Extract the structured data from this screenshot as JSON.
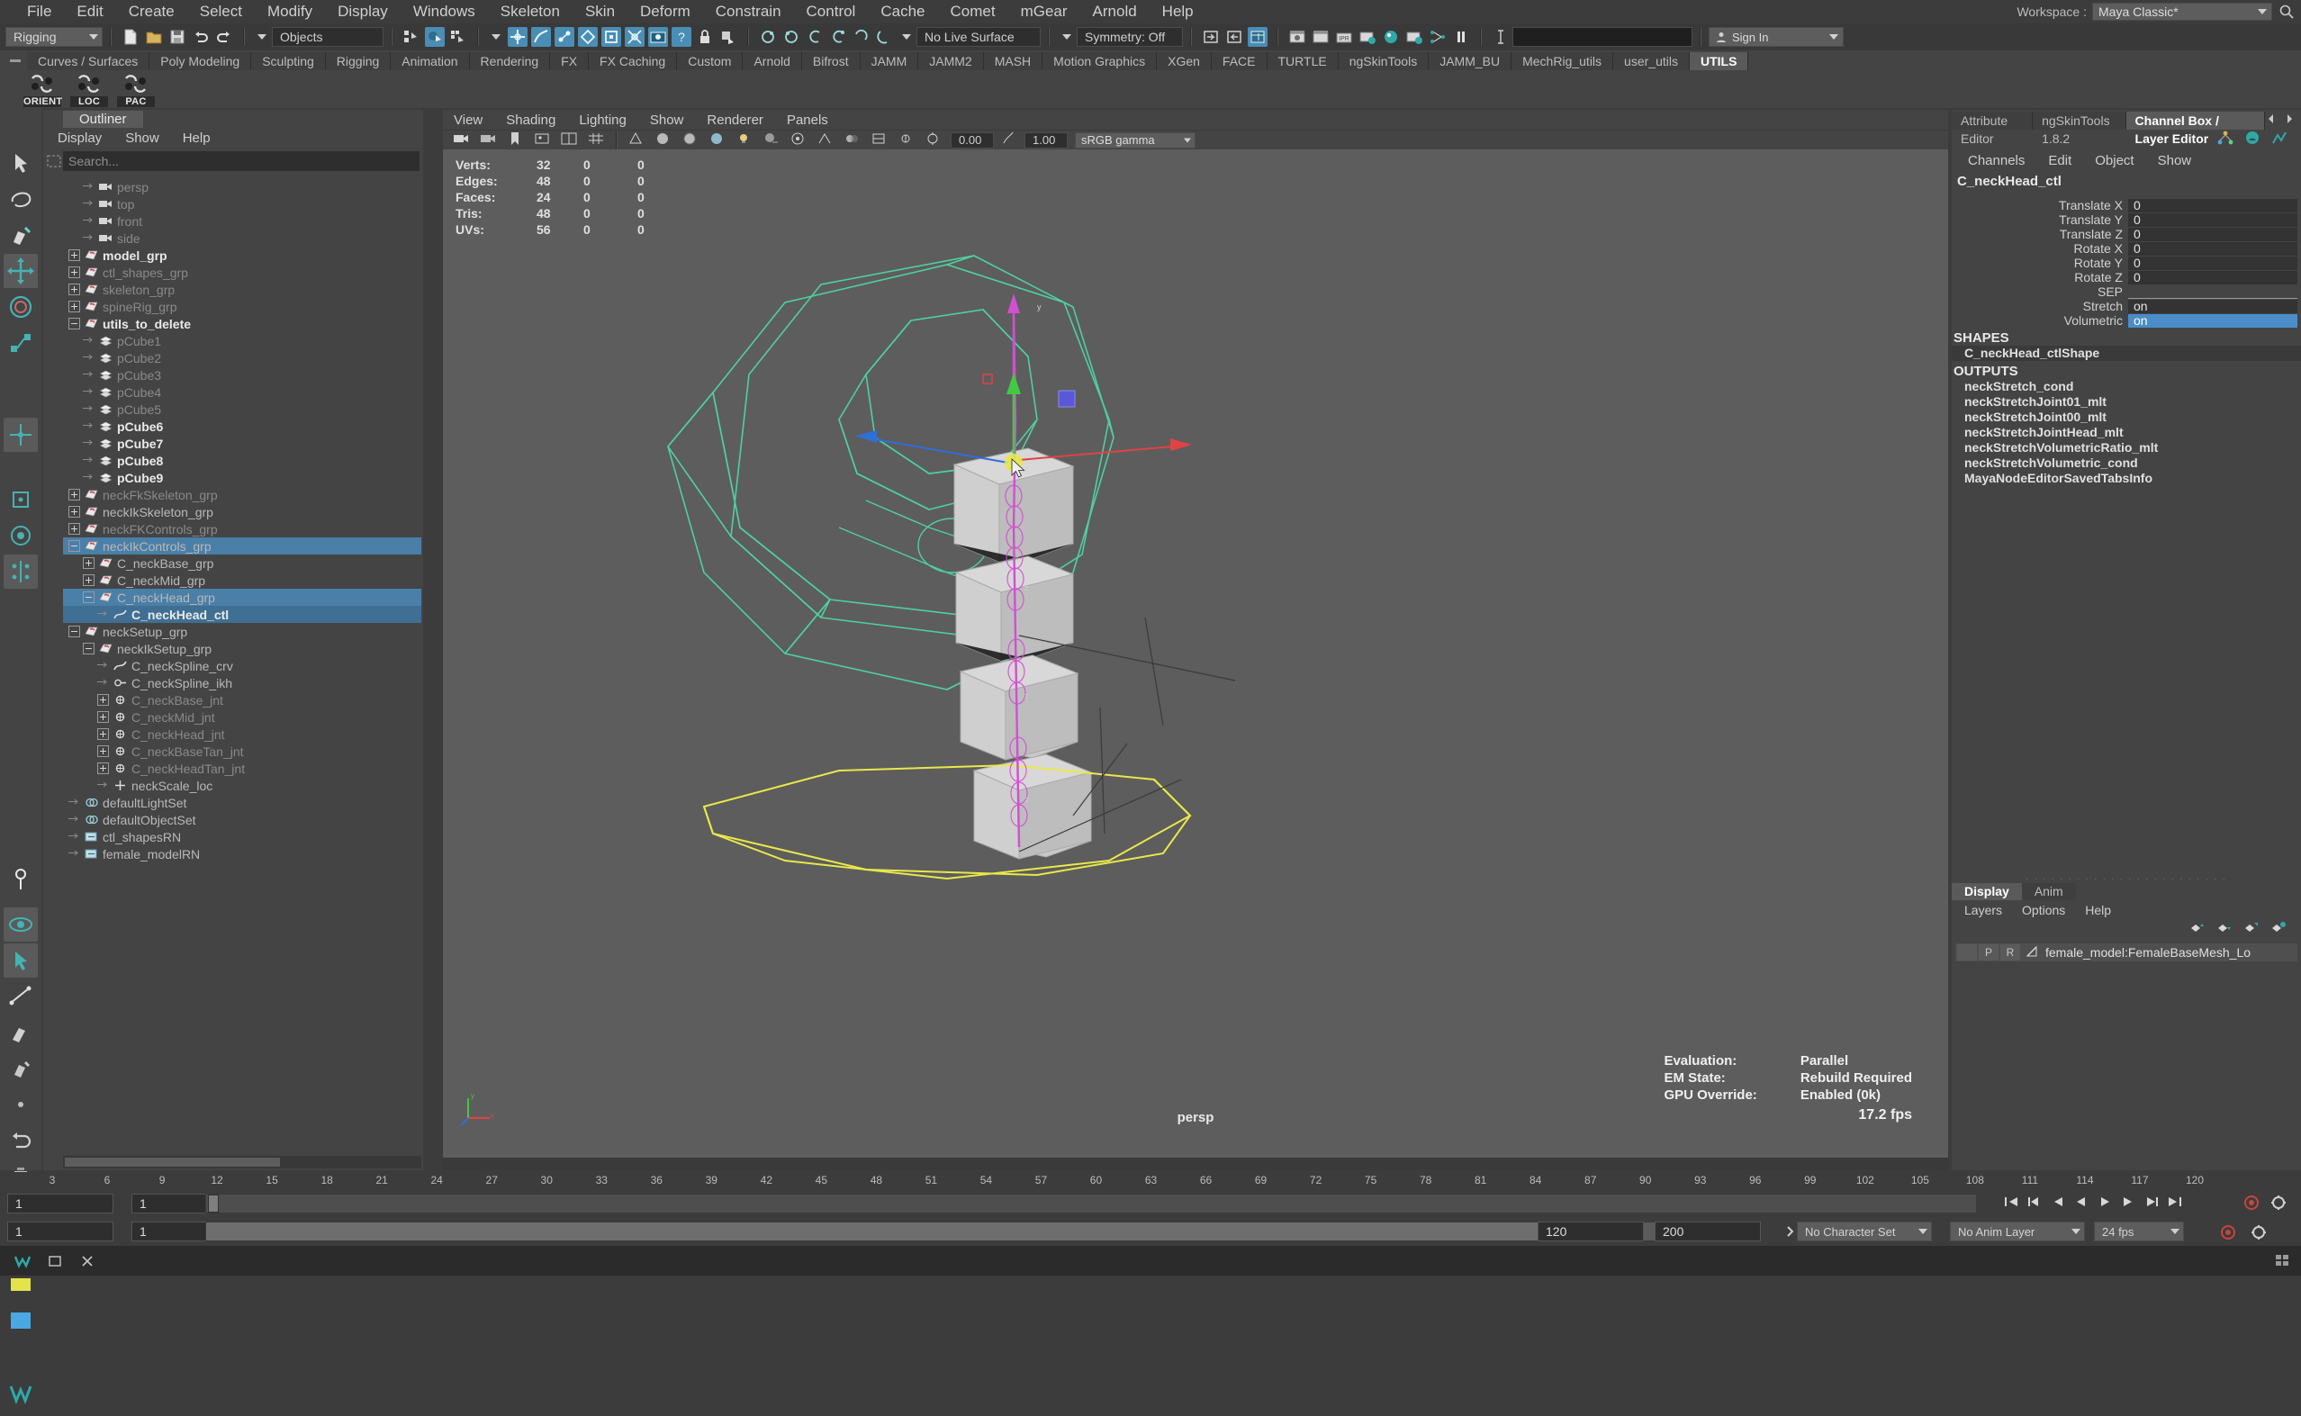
{
  "app": {
    "title": "Maya Classic*",
    "workspace_label": "Workspace :"
  },
  "menubar": {
    "items": [
      "File",
      "Edit",
      "Create",
      "Select",
      "Modify",
      "Display",
      "Windows",
      "Skeleton",
      "Skin",
      "Deform",
      "Constrain",
      "Control",
      "Cache",
      "Comet",
      "mGear",
      "Arnold",
      "Help"
    ]
  },
  "statusline": {
    "mode": "Rigging",
    "selection_mask": "Objects",
    "live_surface": "No Live Surface",
    "symmetry": "Symmetry: Off",
    "command_value": "",
    "signin": "Sign In"
  },
  "shelf": {
    "tabs": [
      "Curves / Surfaces",
      "Poly Modeling",
      "Sculpting",
      "Rigging",
      "Animation",
      "Rendering",
      "FX",
      "FX Caching",
      "Custom",
      "Arnold",
      "Bifrost",
      "JAMM",
      "JAMM2",
      "MASH",
      "Motion Graphics",
      "XGen",
      "FACE",
      "TURTLE",
      "ngSkinTools",
      "JAMM_BU",
      "MechRig_utils",
      "user_utils",
      "UTILS"
    ],
    "active_tab": "UTILS",
    "buttons": [
      {
        "label": "ORIENT",
        "icon": "orient-icon"
      },
      {
        "label": "LOC",
        "icon": "locator-icon"
      },
      {
        "label": "PAC",
        "icon": "parent-constraint-icon"
      }
    ]
  },
  "outliner": {
    "tab": "Outliner",
    "menus": [
      "Display",
      "Show",
      "Help"
    ],
    "search_placeholder": "Search...",
    "items": [
      {
        "label": "persp",
        "indent": 1,
        "icon": "camera-icon",
        "toggle": "none",
        "style": "dim"
      },
      {
        "label": "top",
        "indent": 1,
        "icon": "camera-icon",
        "toggle": "none",
        "style": "dim"
      },
      {
        "label": "front",
        "indent": 1,
        "icon": "camera-icon",
        "toggle": "none",
        "style": "dim"
      },
      {
        "label": "side",
        "indent": 1,
        "icon": "camera-icon",
        "toggle": "none",
        "style": "dim"
      },
      {
        "label": "model_grp",
        "indent": 0,
        "icon": "group-icon",
        "toggle": "plus",
        "style": "bright"
      },
      {
        "label": "ctl_shapes_grp",
        "indent": 0,
        "icon": "group-icon",
        "toggle": "plus",
        "style": "dim"
      },
      {
        "label": "skeleton_grp",
        "indent": 0,
        "icon": "group-icon",
        "toggle": "plus",
        "style": "dim"
      },
      {
        "label": "spineRig_grp",
        "indent": 0,
        "icon": "group-icon",
        "toggle": "plus",
        "style": "dim"
      },
      {
        "label": "utils_to_delete",
        "indent": 0,
        "icon": "group-icon",
        "toggle": "minus",
        "style": "bright"
      },
      {
        "label": "pCube1",
        "indent": 1,
        "icon": "mesh-icon",
        "toggle": "none",
        "style": "dim"
      },
      {
        "label": "pCube2",
        "indent": 1,
        "icon": "mesh-icon",
        "toggle": "none",
        "style": "dim"
      },
      {
        "label": "pCube3",
        "indent": 1,
        "icon": "mesh-icon",
        "toggle": "none",
        "style": "dim"
      },
      {
        "label": "pCube4",
        "indent": 1,
        "icon": "mesh-icon",
        "toggle": "none",
        "style": "dim"
      },
      {
        "label": "pCube5",
        "indent": 1,
        "icon": "mesh-icon",
        "toggle": "none",
        "style": "dim"
      },
      {
        "label": "pCube6",
        "indent": 1,
        "icon": "mesh-icon",
        "toggle": "none",
        "style": "bright"
      },
      {
        "label": "pCube7",
        "indent": 1,
        "icon": "mesh-icon",
        "toggle": "none",
        "style": "bright"
      },
      {
        "label": "pCube8",
        "indent": 1,
        "icon": "mesh-icon",
        "toggle": "none",
        "style": "bright"
      },
      {
        "label": "pCube9",
        "indent": 1,
        "icon": "mesh-icon",
        "toggle": "none",
        "style": "bright"
      },
      {
        "label": "neckFkSkeleton_grp",
        "indent": 0,
        "icon": "group-icon",
        "toggle": "plus",
        "style": "dim"
      },
      {
        "label": "neckIkSkeleton_grp",
        "indent": 0,
        "icon": "group-icon",
        "toggle": "plus",
        "style": "mid"
      },
      {
        "label": "neckFKControls_grp",
        "indent": 0,
        "icon": "group-icon",
        "toggle": "plus",
        "style": "dim"
      },
      {
        "label": "neckIkControls_grp",
        "indent": 0,
        "icon": "group-icon",
        "toggle": "minus",
        "style": "mid",
        "selected": true
      },
      {
        "label": "C_neckBase_grp",
        "indent": 1,
        "icon": "group-icon",
        "toggle": "plus",
        "style": "mid"
      },
      {
        "label": "C_neckMid_grp",
        "indent": 1,
        "icon": "group-icon",
        "toggle": "plus",
        "style": "mid"
      },
      {
        "label": "C_neckHead_grp",
        "indent": 1,
        "icon": "group-icon",
        "toggle": "minus",
        "style": "mid",
        "selected": true
      },
      {
        "label": "C_neckHead_ctl",
        "indent": 2,
        "icon": "curve-icon",
        "toggle": "none",
        "style": "bright",
        "selected_strong": true
      },
      {
        "label": "neckSetup_grp",
        "indent": 0,
        "icon": "group-icon",
        "toggle": "minus",
        "style": "mid"
      },
      {
        "label": "neckIkSetup_grp",
        "indent": 1,
        "icon": "group-icon",
        "toggle": "minus",
        "style": "mid"
      },
      {
        "label": "C_neckSpline_crv",
        "indent": 2,
        "icon": "curve-icon",
        "toggle": "none",
        "style": "mid"
      },
      {
        "label": "C_neckSpline_ikh",
        "indent": 2,
        "icon": "ikhandle-icon",
        "toggle": "none",
        "style": "mid"
      },
      {
        "label": "C_neckBase_jnt",
        "indent": 2,
        "icon": "joint-icon",
        "toggle": "plus",
        "style": "dim"
      },
      {
        "label": "C_neckMid_jnt",
        "indent": 2,
        "icon": "joint-icon",
        "toggle": "plus",
        "style": "dim"
      },
      {
        "label": "C_neckHead_jnt",
        "indent": 2,
        "icon": "joint-icon",
        "toggle": "plus",
        "style": "dim"
      },
      {
        "label": "C_neckBaseTan_jnt",
        "indent": 2,
        "icon": "joint-icon",
        "toggle": "plus",
        "style": "dim"
      },
      {
        "label": "C_neckHeadTan_jnt",
        "indent": 2,
        "icon": "joint-icon",
        "toggle": "plus",
        "style": "dim"
      },
      {
        "label": "neckScale_loc",
        "indent": 2,
        "icon": "locator-icon",
        "toggle": "none",
        "style": "mid"
      },
      {
        "label": "defaultLightSet",
        "indent": 0,
        "icon": "set-icon",
        "toggle": "none",
        "style": "mid"
      },
      {
        "label": "defaultObjectSet",
        "indent": 0,
        "icon": "set-icon",
        "toggle": "none",
        "style": "mid"
      },
      {
        "label": "ctl_shapesRN",
        "indent": 0,
        "icon": "reference-icon",
        "toggle": "none",
        "style": "mid"
      },
      {
        "label": "female_modelRN",
        "indent": 0,
        "icon": "reference-icon",
        "toggle": "none",
        "style": "mid"
      }
    ]
  },
  "viewport": {
    "menus": [
      "View",
      "Shading",
      "Lighting",
      "Show",
      "Renderer",
      "Panels"
    ],
    "exposure": "0.00",
    "gamma": "1.00",
    "colorspace": "sRGB gamma",
    "camera_label": "persp",
    "poly_count": {
      "rows": [
        {
          "name": "Verts:",
          "selected": "32",
          "b": "0",
          "c": "0"
        },
        {
          "name": "Edges:",
          "selected": "48",
          "b": "0",
          "c": "0"
        },
        {
          "name": "Faces:",
          "selected": "24",
          "b": "0",
          "c": "0"
        },
        {
          "name": "Tris:",
          "selected": "48",
          "b": "0",
          "c": "0"
        },
        {
          "name": "UVs:",
          "selected": "56",
          "b": "0",
          "c": "0"
        }
      ]
    },
    "stats": [
      {
        "label": "Evaluation:",
        "value": "Parallel"
      },
      {
        "label": "EM State:",
        "value": "Rebuild Required"
      },
      {
        "label": "GPU Override:",
        "value": "Enabled (0k)"
      }
    ],
    "fps": "17.2 fps"
  },
  "channelbox": {
    "tabs": [
      "Attribute Editor",
      "ngSkinTools 1.8.2",
      "Channel Box / Layer Editor"
    ],
    "active_tab": "Channel Box / Layer Editor",
    "menus": [
      "Channels",
      "Edit",
      "Object",
      "Show"
    ],
    "object_name": "C_neckHead_ctl",
    "attributes": [
      {
        "name": "Translate X",
        "value": "0",
        "kind": "num"
      },
      {
        "name": "Translate Y",
        "value": "0",
        "kind": "num"
      },
      {
        "name": "Translate Z",
        "value": "0",
        "kind": "num"
      },
      {
        "name": "Rotate X",
        "value": "0",
        "kind": "num"
      },
      {
        "name": "Rotate Y",
        "value": "0",
        "kind": "num"
      },
      {
        "name": "Rotate Z",
        "value": "0",
        "kind": "num"
      },
      {
        "name": "SEP",
        "value": "",
        "kind": "sep"
      },
      {
        "name": "Stretch",
        "value": "on",
        "kind": "enum"
      },
      {
        "name": "Volumetric",
        "value": "on",
        "kind": "enum",
        "highlight": true
      }
    ],
    "shapes_header": "SHAPES",
    "shapes": [
      "C_neckHead_ctlShape"
    ],
    "outputs_header": "OUTPUTS",
    "outputs": [
      "neckStretch_cond",
      "neckStretchJoint01_mlt",
      "neckStretchJoint00_mlt",
      "neckStretchJointHead_mlt",
      "neckStretchVolumetricRatio_mlt",
      "neckStretchVolumetric_cond",
      "MayaNodeEditorSavedTabsInfo"
    ]
  },
  "layereditor": {
    "tabs": [
      "Display",
      "Anim"
    ],
    "active_tab": "Display",
    "menus": [
      "Layers",
      "Options",
      "Help"
    ],
    "rows": [
      {
        "vis": "",
        "playback": "P",
        "state": "R",
        "name": "female_model:FemaleBaseMesh_Lo"
      }
    ]
  },
  "timeline": {
    "ticks": [
      "3",
      "6",
      "9",
      "12",
      "15",
      "18",
      "21",
      "24",
      "27",
      "30",
      "33",
      "36",
      "39",
      "42",
      "45",
      "48",
      "51",
      "54",
      "57",
      "60",
      "63",
      "66",
      "69",
      "72",
      "75",
      "78",
      "81",
      "84",
      "87",
      "90",
      "93",
      "96",
      "99",
      "102",
      "105",
      "108",
      "111",
      "114",
      "117",
      "120"
    ],
    "current_frame": "1",
    "current_frame_field": "1",
    "range_start": "1",
    "range_end": "120",
    "anim_start": "120",
    "anim_end": "200",
    "character_set": "No Character Set",
    "anim_layer": "No Anim Layer",
    "frame_rate": "24 fps"
  },
  "colors": {
    "accent": "#4a8dc8",
    "selection_blue": "#4a7fa8",
    "shelf_active": "#5a5a5a",
    "viewport_bg": "#5d5d5d",
    "panel_bg": "#444444",
    "mesh_green": "#4fd0a0",
    "control_yellow": "#e8e84b",
    "control_magenta": "#d24fd2"
  }
}
